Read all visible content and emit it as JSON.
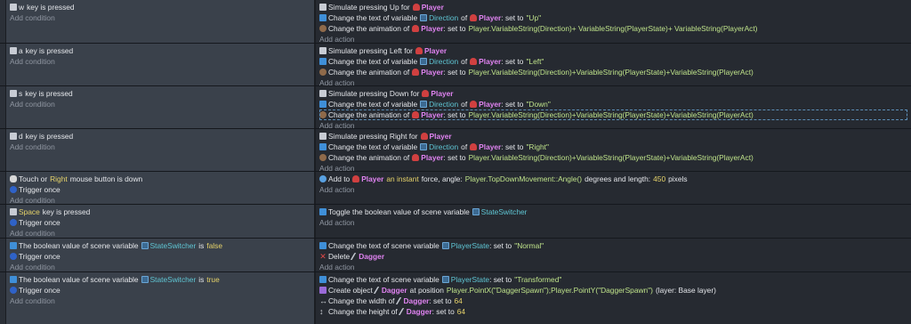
{
  "common": {
    "add_condition": "Add condition",
    "add_action": "Add action"
  },
  "events": [
    {
      "conditions": [
        {
          "key": "w",
          "suffix": "key is pressed"
        }
      ],
      "actions": [
        {
          "a": "Simulate pressing Up for",
          "obj": "Player"
        },
        {
          "a": "Change the text of variable",
          "var": "Direction",
          "of": "of",
          "obj": "Player",
          "set": ": set to",
          "val": "\"Up\""
        },
        {
          "a": "Change the animation of",
          "obj": "Player",
          "set": ": set to",
          "expr": "Player.VariableString(Direction)+ VariableString(PlayerState)+ VariableString(PlayerAct)"
        }
      ]
    },
    {
      "conditions": [
        {
          "key": "a",
          "suffix": "key is pressed"
        }
      ],
      "actions": [
        {
          "a": "Simulate pressing Left for",
          "obj": "Player"
        },
        {
          "a": "Change the text of variable",
          "var": "Direction",
          "of": "of",
          "obj": "Player",
          "set": ": set to",
          "val": "\"Left\""
        },
        {
          "a": "Change the animation of",
          "obj": "Player",
          "set": ": set to",
          "expr": "Player.VariableString(Direction)+VariableString(PlayerState)+VariableString(PlayerAct)"
        }
      ]
    },
    {
      "conditions": [
        {
          "key": "s",
          "suffix": "key is pressed"
        }
      ],
      "actions": [
        {
          "a": "Simulate pressing Down for",
          "obj": "Player"
        },
        {
          "a": "Change the text of variable",
          "var": "Direction",
          "of": "of",
          "obj": "Player",
          "set": ": set to",
          "val": "\"Down\""
        },
        {
          "a": "Change the animation of",
          "obj": "Player",
          "set": ": set to",
          "expr": "Player.VariableString(Direction)+VariableString(PlayerState)+VariableString(PlayerAct)"
        }
      ]
    },
    {
      "conditions": [
        {
          "key": "d",
          "suffix": "key is pressed"
        }
      ],
      "actions": [
        {
          "a": "Simulate pressing Right for",
          "obj": "Player"
        },
        {
          "a": "Change the text of variable",
          "var": "Direction",
          "of": "of",
          "obj": "Player",
          "set": ": set to",
          "val": "\"Right\""
        },
        {
          "a": "Change the animation of",
          "obj": "Player",
          "set": ": set to",
          "expr": "Player.VariableString(Direction)+VariableString(PlayerState)+VariableString(PlayerAct)"
        }
      ]
    },
    {
      "conditions": [
        {
          "pre": "Touch or",
          "hl": "Right",
          "post": "mouse button is down"
        },
        {
          "plain": "Trigger once"
        }
      ],
      "actions": [
        {
          "a": "Add to",
          "obj": "Player",
          "force": "an instant",
          "f2": "force, angle:",
          "expr": "Player.TopDownMovement::Angle()",
          "f3": "degrees and length:",
          "num": "450",
          "f4": "pixels"
        }
      ]
    },
    {
      "conditions": [
        {
          "key": "Space",
          "suffix": "key is pressed"
        },
        {
          "plain": "Trigger once"
        }
      ],
      "actions": [
        {
          "a": "Toggle the boolean value of scene variable",
          "var": "StateSwitcher"
        }
      ]
    },
    {
      "conditions": [
        {
          "pre": "The boolean value of scene variable",
          "var": "StateSwitcher",
          "is": "is",
          "bool": "false"
        },
        {
          "plain": "Trigger once"
        }
      ],
      "actions": [
        {
          "a": "Change the text of scene variable",
          "var": "PlayerState",
          "set": ": set to",
          "val": "\"Normal\""
        },
        {
          "a": "Delete",
          "obj": "Dagger"
        }
      ]
    },
    {
      "conditions": [
        {
          "pre": "The boolean value of scene variable",
          "var": "StateSwitcher",
          "is": "is",
          "bool": "true"
        },
        {
          "plain": "Trigger once"
        }
      ],
      "actions": [
        {
          "a": "Change the text of scene variable",
          "var": "PlayerState",
          "set": ": set to",
          "val": "\"Transformed\""
        },
        {
          "a": "Create object",
          "obj": "Dagger",
          "p2": "at position",
          "expr": "Player.PointX(\"DaggerSpawn\");Player.PointY(\"DaggerSpawn\")",
          "p3": "(layer: Base layer)"
        },
        {
          "a": "Change the width of",
          "obj": "Dagger",
          "set": ": set to",
          "num": "64"
        },
        {
          "a": "Change the height of",
          "obj": "Dagger",
          "set": ": set to",
          "num": "64"
        }
      ]
    }
  ]
}
